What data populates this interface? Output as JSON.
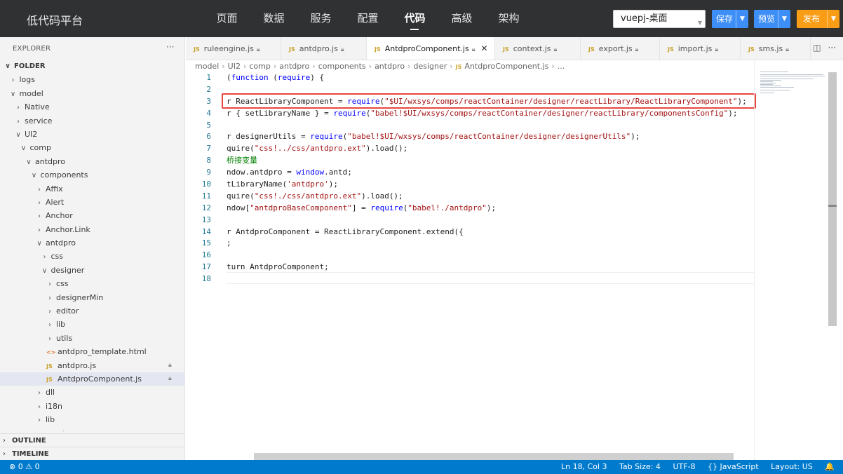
{
  "topbar": {
    "brand": "低代码平台",
    "nav": [
      "页面",
      "数据",
      "服务",
      "配置",
      "代码",
      "高级",
      "架构"
    ],
    "active_nav": "代码",
    "project": "vuepj-桌面",
    "save": "保存",
    "preview": "预览",
    "publish": "发布"
  },
  "explorer": {
    "header": "EXPLORER",
    "more": "···",
    "items": [
      {
        "label": "FOLDER",
        "depth": 0,
        "type": "folder-open",
        "bold": true
      },
      {
        "label": "logs",
        "depth": 1,
        "type": "folder"
      },
      {
        "label": "model",
        "depth": 1,
        "type": "folder-open"
      },
      {
        "label": "Native",
        "depth": 2,
        "type": "folder"
      },
      {
        "label": "service",
        "depth": 2,
        "type": "folder"
      },
      {
        "label": "UI2",
        "depth": 2,
        "type": "folder-open"
      },
      {
        "label": "comp",
        "depth": 3,
        "type": "folder-open"
      },
      {
        "label": "antdpro",
        "depth": 4,
        "type": "folder-open"
      },
      {
        "label": "components",
        "depth": 5,
        "type": "folder-open"
      },
      {
        "label": "Affix",
        "depth": 6,
        "type": "folder"
      },
      {
        "label": "Alert",
        "depth": 6,
        "type": "folder"
      },
      {
        "label": "Anchor",
        "depth": 6,
        "type": "folder"
      },
      {
        "label": "Anchor.Link",
        "depth": 6,
        "type": "folder"
      },
      {
        "label": "antdpro",
        "depth": 6,
        "type": "folder-open"
      },
      {
        "label": "css",
        "depth": 7,
        "type": "folder"
      },
      {
        "label": "designer",
        "depth": 7,
        "type": "folder-open"
      },
      {
        "label": "css",
        "depth": 8,
        "type": "folder"
      },
      {
        "label": "designerMin",
        "depth": 8,
        "type": "folder"
      },
      {
        "label": "editor",
        "depth": 8,
        "type": "folder"
      },
      {
        "label": "lib",
        "depth": 8,
        "type": "folder"
      },
      {
        "label": "utils",
        "depth": 8,
        "type": "folder"
      },
      {
        "label": "antdpro_template.html",
        "depth": 8,
        "type": "html"
      },
      {
        "label": "antdpro.js",
        "depth": 8,
        "type": "js",
        "locked": true
      },
      {
        "label": "AntdproComponent.js",
        "depth": 8,
        "type": "js",
        "locked": true,
        "selected": true
      },
      {
        "label": "dll",
        "depth": 6,
        "type": "folder"
      },
      {
        "label": "i18n",
        "depth": 6,
        "type": "folder"
      },
      {
        "label": "lib",
        "depth": 6,
        "type": "folder"
      },
      {
        "label": "react",
        "depth": 6,
        "type": "folder"
      }
    ],
    "outline": "OUTLINE",
    "timeline": "TIMELINE"
  },
  "tabs": [
    {
      "label": "ruleengine.js",
      "locked": true
    },
    {
      "label": "antdpro.js",
      "locked": true
    },
    {
      "label": "AntdproComponent.js",
      "locked": true,
      "active": true
    },
    {
      "label": "context.js",
      "locked": true
    },
    {
      "label": "export.js",
      "locked": true
    },
    {
      "label": "import.js",
      "locked": true
    },
    {
      "label": "sms.js",
      "locked": true
    }
  ],
  "breadcrumb": [
    "model",
    "UI2",
    "comp",
    "antdpro",
    "components",
    "antdpro",
    "designer",
    "AntdproComponent.js",
    "..."
  ],
  "code_lines": [
    {
      "n": "1",
      "text": "(function (require) {"
    },
    {
      "n": "2",
      "text": ""
    },
    {
      "n": "3",
      "text": "r ReactLibraryComponent = require(\"$UI/wxsys/comps/reactContainer/designer/reactLibrary/ReactLibraryComponent\");"
    },
    {
      "n": "4",
      "text": "r { setLibraryName } = require(\"babel!$UI/wxsys/comps/reactContainer/designer/reactLibrary/componentsConfig\");"
    },
    {
      "n": "5",
      "text": ""
    },
    {
      "n": "6",
      "text": "r designerUtils = require(\"babel!$UI/wxsys/comps/reactContainer/designer/designerUtils\");"
    },
    {
      "n": "7",
      "text": "quire(\"css!../css/antdpro.ext\").load();"
    },
    {
      "n": "8",
      "text": "桥接变量",
      "comment": true
    },
    {
      "n": "9",
      "text": "ndow.antdpro = window.antd;"
    },
    {
      "n": "10",
      "text": "tLibraryName('antdpro');"
    },
    {
      "n": "11",
      "text": "quire(\"css!./css/antdpro.ext\").load();"
    },
    {
      "n": "12",
      "text": "ndow[\"antdproBaseComponent\"] = require(\"babel!./antdpro\");"
    },
    {
      "n": "13",
      "text": ""
    },
    {
      "n": "14",
      "text": "r AntdproComponent = ReactLibraryComponent.extend({"
    },
    {
      "n": "15",
      "text": ";"
    },
    {
      "n": "16",
      "text": ""
    },
    {
      "n": "17",
      "text": "turn AntdproComponent;"
    },
    {
      "n": "18",
      "text": ""
    }
  ],
  "statusbar": {
    "problems": "⊗ 0 ⚠ 0",
    "position": "Ln 18, Col 3",
    "tab_size": "Tab Size: 4",
    "encoding": "UTF-8",
    "language": "{} JavaScript",
    "layout": "Layout: US",
    "bell": "🔔"
  }
}
